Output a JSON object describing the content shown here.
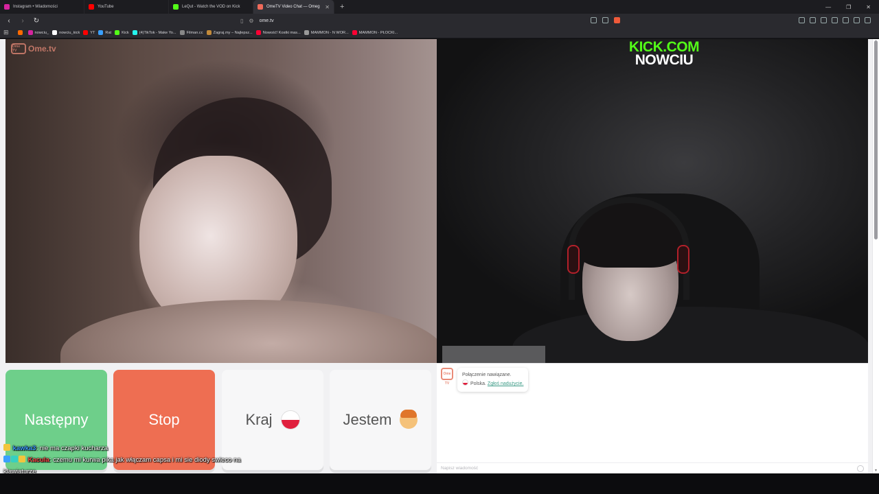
{
  "browser": {
    "tabs": [
      {
        "label": "Instagram • Wiadomości",
        "color": "#d6249f",
        "active": false
      },
      {
        "label": "YouTube",
        "color": "#ff0000",
        "active": false
      },
      {
        "label": "LeQut - Watch the VOD on Kick",
        "color": "#53fc18",
        "active": false
      },
      {
        "label": "OmeTV Video Chat — Omeg",
        "color": "#ef6a5a",
        "active": true
      }
    ],
    "new_tab_label": "+",
    "url": "ome.tv",
    "bookmarks": [
      {
        "label": "",
        "color": "#ff6a00"
      },
      {
        "label": "nowciu_",
        "color": "#d6249f"
      },
      {
        "label": "nowciu_kick",
        "color": "#ffffff"
      },
      {
        "label": "YT",
        "color": "#ff0000"
      },
      {
        "label": "Rat",
        "color": "#3aa0ff"
      },
      {
        "label": "Kick",
        "color": "#53fc18"
      },
      {
        "label": "(4)TikTok - Make Yo...",
        "color": "#25f4ee"
      },
      {
        "label": "Filman.cc",
        "color": "#888888"
      },
      {
        "label": "Zagraj.my – Najlepsz...",
        "color": "#c28a3a"
      },
      {
        "label": "Nowość! Kostki mas...",
        "color": "#ff0033"
      },
      {
        "label": "MAMMON - N WOR...",
        "color": "#999999"
      },
      {
        "label": "MAMMON - PŁOCKI...",
        "color": "#ff0033"
      }
    ]
  },
  "video": {
    "logo_text": "Ome.tv",
    "logo_box": "Ome TV",
    "kick_line1": "KICK.COM",
    "kick_line2": "NOWCIU"
  },
  "controls": {
    "next_label": "Następny",
    "stop_label": "Stop",
    "country_label": "Kraj",
    "gender_label": "Jestem"
  },
  "chat": {
    "avatar_text": "Ome TV",
    "connected_text": "Połączenie nawiązane.",
    "country_text": "Polska.",
    "report_link": "Zgłoś nadużycie.",
    "input_placeholder": "Napisz wiadomość"
  },
  "stream_chat": [
    {
      "user": "kawka3",
      "message": ": nie ma czapki kucharza"
    },
    {
      "user": "Kacula",
      "message": ": czemu mi kurwa pika jak włączam capsa i mi sie diody swieco na klawiaturze"
    }
  ],
  "colors": {
    "next": "#6ecf8a",
    "stop": "#ee6e52",
    "kick_green": "#53fc18"
  }
}
